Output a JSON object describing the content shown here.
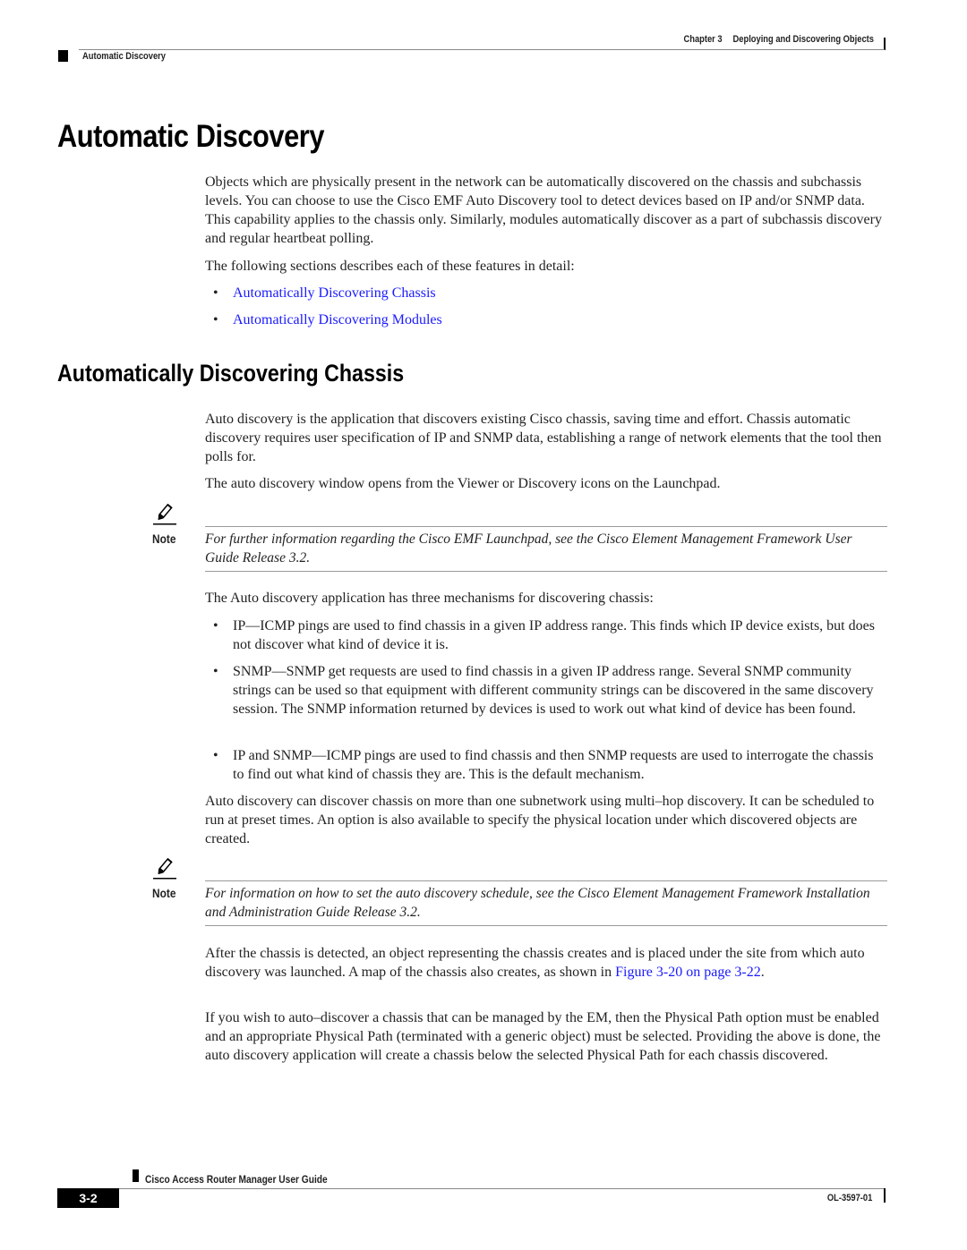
{
  "header": {
    "chapter": "Chapter 3",
    "chapter_title": "Deploying and Discovering Objects",
    "section": "Automatic Discovery"
  },
  "title": "Automatic Discovery",
  "intro": {
    "paragraph1": "Objects which are physically present in the network can be automatically discovered on the chassis and subchassis levels. You can choose to use the Cisco EMF Auto Discovery tool to detect devices based on IP and/or SNMP data. This capability applies to the chassis only. Similarly, modules automatically discover as a part of subchassis discovery and regular heartbeat polling.",
    "paragraph2": "The following sections describes each of these features in detail:",
    "links": [
      {
        "label": "Automatically Discovering Chassis"
      },
      {
        "label": "Automatically Discovering Modules"
      }
    ]
  },
  "section": {
    "title": "Automatically Discovering Chassis",
    "paragraph1": "Auto discovery is the application that discovers existing Cisco chassis, saving time and effort. Chassis automatic discovery requires user specification of IP and SNMP data, establishing a range of network elements that the tool then polls for.",
    "paragraph2": "The auto discovery window opens from the Viewer or Discovery icons on the Launchpad.",
    "note1": {
      "label": "Note",
      "text": "For further information regarding the Cisco EMF Launchpad, see the Cisco Element Management Framework User Guide Release 3.2."
    },
    "paragraph3": "The Auto discovery application has three mechanisms for discovering chassis:",
    "bullets": [
      {
        "text": "IP—ICMP pings are used to find chassis in a given IP address range. This finds which IP device exists, but does not discover what kind of device it is."
      },
      {
        "text": "SNMP—SNMP get requests are used to find chassis in a given IP address range. Several SNMP community strings can be used so that equipment with different community strings can be discovered in the same discovery session. The SNMP information returned by devices is used to work out what kind of device has been found."
      },
      {
        "text": "IP and SNMP—ICMP pings are used to find chassis and then SNMP requests are used to interrogate the chassis to find out what kind of chassis they are. This is the default mechanism."
      }
    ],
    "paragraph4": "Auto discovery can discover chassis on more than one subnetwork using multi–hop discovery. It can be scheduled to run at preset times. An option is also available to specify the physical location under which discovered objects are created.",
    "note2": {
      "label": "Note",
      "text": "For information on how to set the auto discovery schedule, see the Cisco Element Management Framework Installation and Administration Guide Release 3.2."
    },
    "paragraph5_pre": "After the chassis is detected, an object representing the chassis creates and is placed under the site from which auto discovery was launched. A map of the chassis also creates, as shown in ",
    "paragraph5_link": "Figure 3-20 on page 3-22",
    "paragraph5_post": ".",
    "paragraph6": "If you wish to auto–discover a chassis that can be managed by the EM, then the Physical Path option must be enabled and an appropriate Physical Path (terminated with a generic object) must be selected. Providing the above is done, the auto discovery application will create a chassis below the selected Physical Path for each chassis discovered."
  },
  "footer": {
    "guide_title": "Cisco Access Router Manager User Guide",
    "page_number": "3-2",
    "doc_number": "OL-3597-01"
  },
  "colors": {
    "link": "#1a1aff",
    "text": "#222222"
  }
}
